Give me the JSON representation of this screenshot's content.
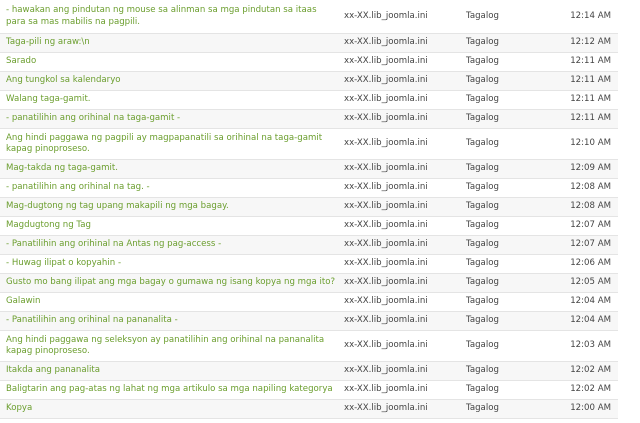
{
  "rows": [
    {
      "text": "- hawakan ang pindutan ng mouse sa alinman sa mga pindutan sa itaas para sa mas mabilis na pagpili.",
      "file": "xx-XX.lib_joomla.ini",
      "language": "Tagalog",
      "time": "12:14 AM"
    },
    {
      "text": "Taga-pili ng araw:\\n",
      "file": "xx-XX.lib_joomla.ini",
      "language": "Tagalog",
      "time": "12:12 AM"
    },
    {
      "text": "Sarado",
      "file": "xx-XX.lib_joomla.ini",
      "language": "Tagalog",
      "time": "12:11 AM"
    },
    {
      "text": "Ang tungkol sa kalendaryo",
      "file": "xx-XX.lib_joomla.ini",
      "language": "Tagalog",
      "time": "12:11 AM"
    },
    {
      "text": "Walang taga-gamit.",
      "file": "xx-XX.lib_joomla.ini",
      "language": "Tagalog",
      "time": "12:11 AM"
    },
    {
      "text": "- panatilihin ang orihinal na taga-gamit -",
      "file": "xx-XX.lib_joomla.ini",
      "language": "Tagalog",
      "time": "12:11 AM"
    },
    {
      "text": "Ang hindi paggawa ng pagpili ay magpapanatili sa orihinal na taga-gamit kapag pinoproseso.",
      "file": "xx-XX.lib_joomla.ini",
      "language": "Tagalog",
      "time": "12:10 AM"
    },
    {
      "text": "Mag-takda ng taga-gamit.",
      "file": "xx-XX.lib_joomla.ini",
      "language": "Tagalog",
      "time": "12:09 AM"
    },
    {
      "text": "- panatilihin ang orihinal na tag. -",
      "file": "xx-XX.lib_joomla.ini",
      "language": "Tagalog",
      "time": "12:08 AM"
    },
    {
      "text": "Mag-dugtong ng tag upang makapili ng mga bagay.",
      "file": "xx-XX.lib_joomla.ini",
      "language": "Tagalog",
      "time": "12:08 AM"
    },
    {
      "text": "Magdugtong ng Tag",
      "file": "xx-XX.lib_joomla.ini",
      "language": "Tagalog",
      "time": "12:07 AM"
    },
    {
      "text": "- Panatilihin ang orihinal na Antas ng pag-access -",
      "file": "xx-XX.lib_joomla.ini",
      "language": "Tagalog",
      "time": "12:07 AM"
    },
    {
      "text": "- Huwag ilipat o kopyahin -",
      "file": "xx-XX.lib_joomla.ini",
      "language": "Tagalog",
      "time": "12:06 AM"
    },
    {
      "text": "Gusto mo bang ilipat ang mga bagay o gumawa ng isang kopya ng mga ito?",
      "file": "xx-XX.lib_joomla.ini",
      "language": "Tagalog",
      "time": "12:05 AM"
    },
    {
      "text": "Galawin",
      "file": "xx-XX.lib_joomla.ini",
      "language": "Tagalog",
      "time": "12:04 AM"
    },
    {
      "text": "- Panatilihin ang orihinal na pananalita -",
      "file": "xx-XX.lib_joomla.ini",
      "language": "Tagalog",
      "time": "12:04 AM"
    },
    {
      "text": "Ang hindi paggawa ng seleksyon ay panatilihin ang orihinal na pananalita kapag pinoproseso.",
      "file": "xx-XX.lib_joomla.ini",
      "language": "Tagalog",
      "time": "12:03 AM"
    },
    {
      "text": "Itakda ang pananalita",
      "file": "xx-XX.lib_joomla.ini",
      "language": "Tagalog",
      "time": "12:02 AM"
    },
    {
      "text": "Baligtarin ang pag-atas ng lahat ng mga artikulo sa mga napiling kategorya",
      "file": "xx-XX.lib_joomla.ini",
      "language": "Tagalog",
      "time": "12:02 AM"
    },
    {
      "text": "Kopya",
      "file": "xx-XX.lib_joomla.ini",
      "language": "Tagalog",
      "time": "12:00 AM"
    }
  ]
}
